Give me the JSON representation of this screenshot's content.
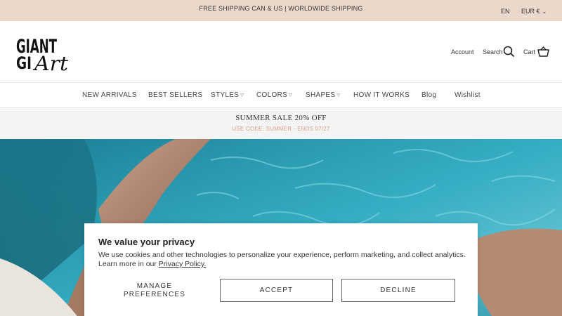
{
  "announcement": {
    "text": "FREE SHIPPING CAN & US | WORLDWIDE SHIPPING",
    "language": "EN",
    "currency": "EUR €"
  },
  "header": {
    "logo_text": "GIANT Art",
    "account_label": "Account",
    "search_label": "Search",
    "cart_label": "Cart"
  },
  "nav": {
    "items": [
      {
        "label": "NEW ARRIVALS"
      },
      {
        "label": "BEST SELLERS"
      },
      {
        "label": "STYLES"
      },
      {
        "label": "COLORS"
      },
      {
        "label": "SHAPES"
      },
      {
        "label": "HOW IT WORKS"
      },
      {
        "label": "Blog"
      },
      {
        "label": "Wishlist"
      }
    ]
  },
  "promo": {
    "title": "SUMMER SALE 20% OFF",
    "subtitle": "USE CODE: SUMMER - ENDS 07/27"
  },
  "cookie_banner": {
    "title": "We value your privacy",
    "text": "We use cookies and other technologies to personalize your experience, perform marketing, and collect analytics. Learn more in our ",
    "link_text": "Privacy Policy.",
    "manage_line1": "MANAGE",
    "manage_line2": "PREFERENCES",
    "accept_label": "ACCEPT",
    "decline_label": "DECLINE"
  },
  "colors": {
    "announcement_bg": "#ead8cb",
    "promo_subtitle": "#d9a08f",
    "pool_water": "#2a9ab0"
  }
}
